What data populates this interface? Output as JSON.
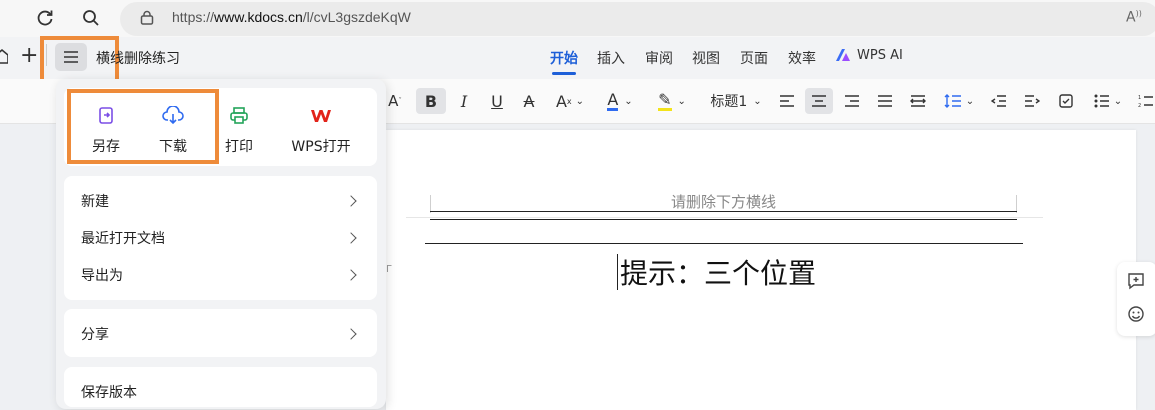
{
  "browser": {
    "url_scheme": "https://",
    "url_host": "www.kdocs.cn",
    "url_path": "/l/cvL3gszdeKqW",
    "reader_mode": "A⁾"
  },
  "doc_title": "横线删除练习",
  "tabs": [
    "开始",
    "插入",
    "审阅",
    "视图",
    "页面",
    "效率"
  ],
  "wps_ai": "WPS AI",
  "toolbar": {
    "heading_style": "标题1"
  },
  "menu": {
    "top_actions": [
      {
        "label": "另存",
        "icon": "save-as-icon"
      },
      {
        "label": "下载",
        "icon": "cloud-download-icon"
      },
      {
        "label": "打印",
        "icon": "printer-icon"
      },
      {
        "label": "WPS打开",
        "icon": "wps-logo-icon"
      }
    ],
    "group1": [
      "新建",
      "最近打开文档",
      "导出为"
    ],
    "group2": [
      "分享"
    ],
    "group3": [
      "保存版本"
    ]
  },
  "document": {
    "header_text": "请删除下方横线",
    "hint_text": "提示：三个位置"
  },
  "colors": {
    "accent": "#1d5fd8",
    "highlight_box": "#ee8b3a"
  }
}
